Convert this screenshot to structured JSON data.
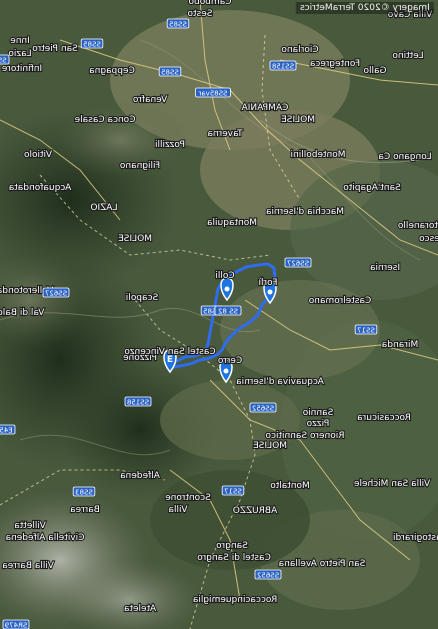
{
  "map": {
    "attribution": "Imagery ©2020 TerraMetrics",
    "labels": [
      {
        "id": "campobasso-top",
        "text": "Cambobo"
      },
      {
        "id": "sesto",
        "text": "Sesto"
      },
      {
        "id": "villa-cavo",
        "text": "Villa Cavo"
      },
      {
        "id": "inne",
        "text": "Inne"
      },
      {
        "id": "san-pietro",
        "text": "San Pietro"
      },
      {
        "id": "lazio-top",
        "text": "Lazio"
      },
      {
        "id": "ciorlano",
        "text": "Ciorlano"
      },
      {
        "id": "lettino",
        "text": "Lettino"
      },
      {
        "id": "infinitore",
        "text": "Infinitore"
      },
      {
        "id": "ceppagna",
        "text": "Ceppagna"
      },
      {
        "id": "fontegreca",
        "text": "Fontegreca"
      },
      {
        "id": "gallo",
        "text": "Gallo"
      },
      {
        "id": "venafro",
        "text": "Venafro"
      },
      {
        "id": "conca-casale",
        "text": "Conca Casale"
      },
      {
        "id": "campania",
        "text": "CAMPANIA"
      },
      {
        "id": "molise-ne",
        "text": "MOLISE"
      },
      {
        "id": "pozzilli",
        "text": "Pozzilli"
      },
      {
        "id": "taverna",
        "text": "Taverna"
      },
      {
        "id": "vitiolo",
        "text": "Vitiolo"
      },
      {
        "id": "montebollini",
        "text": "Montebollini"
      },
      {
        "id": "longano",
        "text": "Longano Ca"
      },
      {
        "id": "acquafondata",
        "text": "Acquafondata"
      },
      {
        "id": "filignano",
        "text": "Filignano"
      },
      {
        "id": "sant-agapito",
        "text": "Sant'Agapito"
      },
      {
        "id": "lazio-mid",
        "text": "LAZIO"
      },
      {
        "id": "montaquila",
        "text": "Montaquila"
      },
      {
        "id": "macchia",
        "text": "Macchia d'Isernia"
      },
      {
        "id": "molise-w",
        "text": "MOLISE"
      },
      {
        "id": "pesco",
        "text": "Pesco"
      },
      {
        "id": "isernia",
        "text": "Isernia"
      },
      {
        "id": "vallerotonda",
        "text": "Vallerotonda"
      },
      {
        "id": "valdibaldo",
        "text": "Val di Baldo"
      },
      {
        "id": "scapoli",
        "text": "Scapoli"
      },
      {
        "id": "colli",
        "text": "Colli"
      },
      {
        "id": "forli",
        "text": "Forlì"
      },
      {
        "id": "castelromano",
        "text": "Castelromano"
      },
      {
        "id": "pettoranello",
        "text": "Pettoranello"
      },
      {
        "id": "miranda",
        "text": "Miranda"
      },
      {
        "id": "pizzone",
        "text": "Pizzone"
      },
      {
        "id": "castel-vincenzo",
        "text": "Castel San Vincenzo"
      },
      {
        "id": "cerro",
        "text": "Cerro"
      },
      {
        "id": "acquaviva",
        "text": "Acquaviva d'Isernia"
      },
      {
        "id": "roccasicura",
        "text": "Roccasicura"
      },
      {
        "id": "rionero",
        "text": "Rionero Sannitico"
      },
      {
        "id": "sannio",
        "text": "Sannio"
      },
      {
        "id": "pizzo",
        "text": "Pizzo"
      },
      {
        "id": "alfedena",
        "text": "Alfedena"
      },
      {
        "id": "molise-s",
        "text": "MOLISE"
      },
      {
        "id": "abruzzo",
        "text": "ABRUZZO"
      },
      {
        "id": "scontrone",
        "text": "Scontrone"
      },
      {
        "id": "montalto",
        "text": "Montalto"
      },
      {
        "id": "barrea",
        "text": "Barrea"
      },
      {
        "id": "villetta",
        "text": "Villetta"
      },
      {
        "id": "civitella",
        "text": "Civitella Alfedena"
      },
      {
        "id": "villa",
        "text": "Villa"
      },
      {
        "id": "vastogirardi",
        "text": "Vastogirardi"
      },
      {
        "id": "villa-san-michele",
        "text": "Villa San Michele"
      },
      {
        "id": "sangro",
        "text": "Sangro"
      },
      {
        "id": "castel-sangro",
        "text": "Castel di Sangro"
      },
      {
        "id": "san-pietro-avellana",
        "text": "San Pietro Avellana"
      },
      {
        "id": "roccacinquemiglia",
        "text": "Roccacinquemiglia"
      },
      {
        "id": "ateleta",
        "text": "Ateleta"
      },
      {
        "id": "villa-barrea",
        "text": "Villa Barrea"
      }
    ],
    "road_shields": [
      {
        "id": "ss6-top",
        "text": "SS85"
      },
      {
        "id": "ss85-a",
        "text": "SS85"
      },
      {
        "id": "ss6-left",
        "text": "SS6"
      },
      {
        "id": "ss85-b",
        "text": "SS85"
      },
      {
        "id": "ss85var",
        "text": "SS85var"
      },
      {
        "id": "ss158",
        "text": "SS158"
      },
      {
        "id": "sp527",
        "text": "SS627"
      },
      {
        "id": "ss627b",
        "text": "SS627"
      },
      {
        "id": "ss85-c",
        "text": "SS85"
      },
      {
        "id": "ss85-d",
        "text": "SS 82"
      },
      {
        "id": "ss17",
        "text": "SS17"
      },
      {
        "id": "ss158b",
        "text": "SS158"
      },
      {
        "id": "ss652",
        "text": "SS652"
      },
      {
        "id": "ss83",
        "text": "SS83"
      },
      {
        "id": "ss17b",
        "text": "SS17"
      },
      {
        "id": "ss652b",
        "text": "SS652"
      },
      {
        "id": "e45",
        "text": "E45"
      },
      {
        "id": "sr479",
        "text": "SR479"
      }
    ],
    "markers": [
      {
        "id": "start-end",
        "text": "E",
        "color": "#1e74e0"
      },
      {
        "id": "waypoint-colli",
        "text": "",
        "color": "#1e74e0"
      },
      {
        "id": "waypoint-forli",
        "text": "",
        "color": "#1e74e0"
      },
      {
        "id": "waypoint-cerro",
        "text": "",
        "color": "#1e74e0"
      }
    ],
    "colors": {
      "route": "#2f6cf0",
      "shield": "#2a62c4",
      "terrain": "#4b5e3f"
    }
  }
}
